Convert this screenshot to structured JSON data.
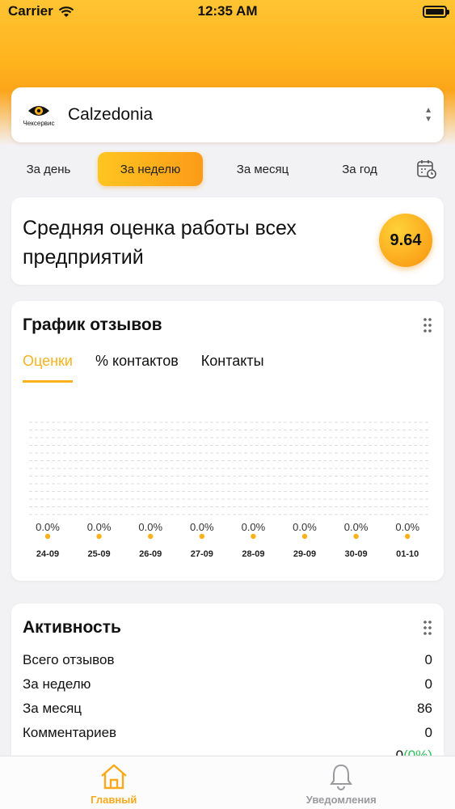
{
  "status_bar": {
    "carrier": "Carrier",
    "time": "12:35 AM"
  },
  "company": {
    "logo_text": "Чексервис",
    "name": "Calzedonia"
  },
  "periods": [
    {
      "label": "За день",
      "active": false
    },
    {
      "label": "За неделю",
      "active": true
    },
    {
      "label": "За месяц",
      "active": false
    },
    {
      "label": "За год",
      "active": false
    }
  ],
  "score": {
    "title": "Средняя оценка работы всех предприятий",
    "value": "9.64"
  },
  "reviews_chart": {
    "title": "График отзывов",
    "tabs": [
      {
        "label": "Оценки",
        "active": true
      },
      {
        "label": "% контактов",
        "active": false
      },
      {
        "label": "Контакты",
        "active": false
      }
    ]
  },
  "chart_data": {
    "type": "scatter",
    "title": "График отзывов",
    "categories": [
      "24-09",
      "25-09",
      "26-09",
      "27-09",
      "28-09",
      "29-09",
      "30-09",
      "01-10"
    ],
    "values": [
      0.0,
      0.0,
      0.0,
      0.0,
      0.0,
      0.0,
      0.0,
      0.0
    ],
    "data_labels": [
      "0.0%",
      "0.0%",
      "0.0%",
      "0.0%",
      "0.0%",
      "0.0%",
      "0.0%",
      "0.0%"
    ],
    "grid": true,
    "point_color": "#f9b21b"
  },
  "activity": {
    "title": "Активность",
    "rows": [
      {
        "label": "Всего отзывов",
        "value": "0"
      },
      {
        "label": "За неделю",
        "value": "0"
      },
      {
        "label": "За месяц",
        "value": "86"
      },
      {
        "label": "Комментариев",
        "value": "0"
      }
    ],
    "partial_value": "0",
    "partial_extra": "(0%)"
  },
  "tab_bar": {
    "items": [
      {
        "label": "Главный",
        "icon": "home-icon",
        "active": true
      },
      {
        "label": "Уведомления",
        "icon": "bell-icon",
        "active": false
      }
    ]
  },
  "colors": {
    "accent": "#f9b21b",
    "accent_dark": "#fb9b18",
    "green": "#2ec15a"
  }
}
